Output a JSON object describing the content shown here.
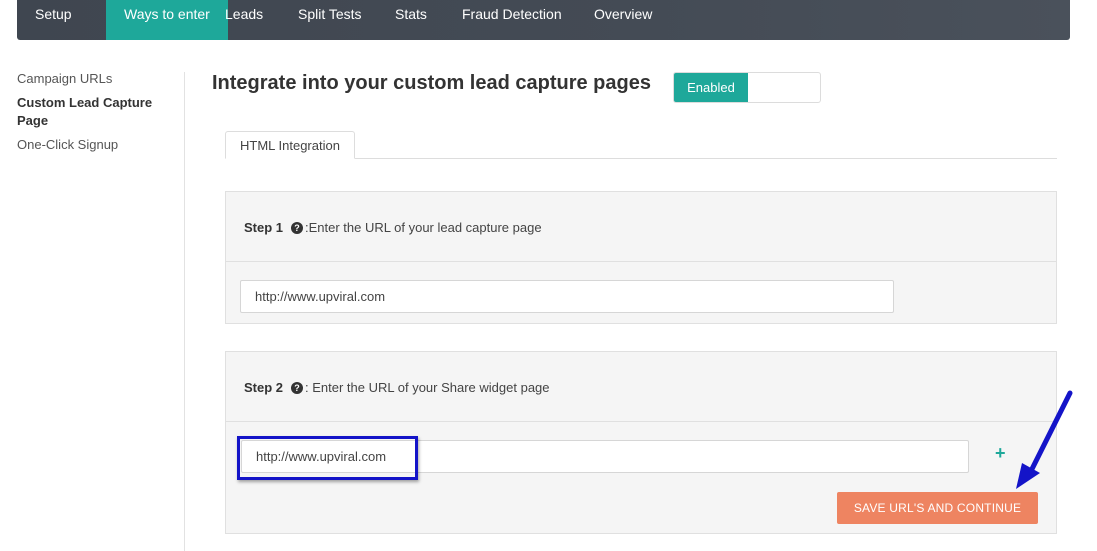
{
  "topnav": {
    "tabs": [
      {
        "label": "Setup"
      },
      {
        "label": "Ways to enter",
        "active": true
      },
      {
        "label": "Leads"
      },
      {
        "label": "Split Tests"
      },
      {
        "label": "Stats"
      },
      {
        "label": "Fraud Detection"
      },
      {
        "label": "Overview"
      }
    ]
  },
  "sidebar": {
    "items": [
      {
        "label": "Campaign URLs"
      },
      {
        "label": "Custom Lead Capture Page",
        "active": true
      },
      {
        "label": "One-Click Signup"
      }
    ]
  },
  "main": {
    "title": "Integrate into your custom lead capture pages",
    "toggle_label": "Enabled",
    "tab_label": "HTML Integration",
    "step1": {
      "label": "Step 1",
      "text": ":Enter the URL of your lead capture page",
      "url_value": "http://www.upviral.com"
    },
    "step2": {
      "label": "Step 2",
      "text": ": Enter the URL of your Share widget page",
      "url_value": "http://www.upviral.com"
    },
    "add_symbol": "+",
    "save_button": "SAVE URL'S AND CONTINUE"
  },
  "colors": {
    "accent": "#1ea89a",
    "nav_bg": "#444b55",
    "save_button": "#ee8461",
    "annotation": "#1414c8"
  },
  "icons": [
    "question-circle-icon",
    "plus-icon",
    "annotation-arrow-icon"
  ]
}
